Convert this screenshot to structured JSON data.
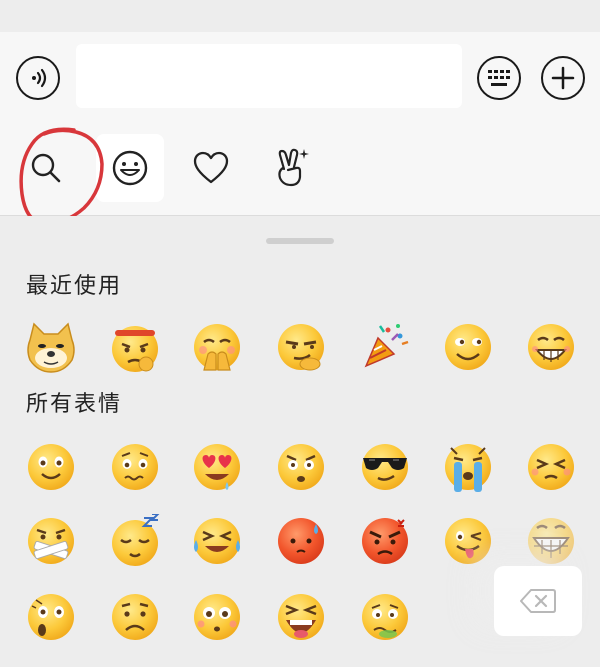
{
  "input_bar": {
    "text_value": "",
    "voice_icon": "voice-icon",
    "keyboard_icon": "keyboard-icon",
    "plus_icon": "plus-icon"
  },
  "tabs": [
    {
      "name": "search",
      "icon": "search-icon",
      "active": false,
      "annotated": true
    },
    {
      "name": "emoji",
      "icon": "smiley-icon",
      "active": true
    },
    {
      "name": "favorites",
      "icon": "heart-icon",
      "active": false
    },
    {
      "name": "stickers",
      "icon": "victory-hand-icon",
      "active": false
    }
  ],
  "annotation_color": "#d8373b",
  "sections": {
    "recent_title": "最近使用",
    "all_title": "所有表情"
  },
  "recent_emojis": [
    "doge",
    "fighting",
    "respect",
    "smirk",
    "party-popper",
    "sly-smile",
    "grin"
  ],
  "all_emojis": [
    [
      "smile",
      "worried",
      "heart-eyes",
      "shocked",
      "cool",
      "crying",
      "squint"
    ],
    [
      "shush",
      "sleepy",
      "tears-of-joy",
      "embarrassed",
      "angry",
      "tongue",
      "big-grin"
    ],
    [
      "surprised",
      "sad",
      "pleading",
      "wail",
      "dizzy"
    ]
  ],
  "delete_icon": "backspace-icon"
}
